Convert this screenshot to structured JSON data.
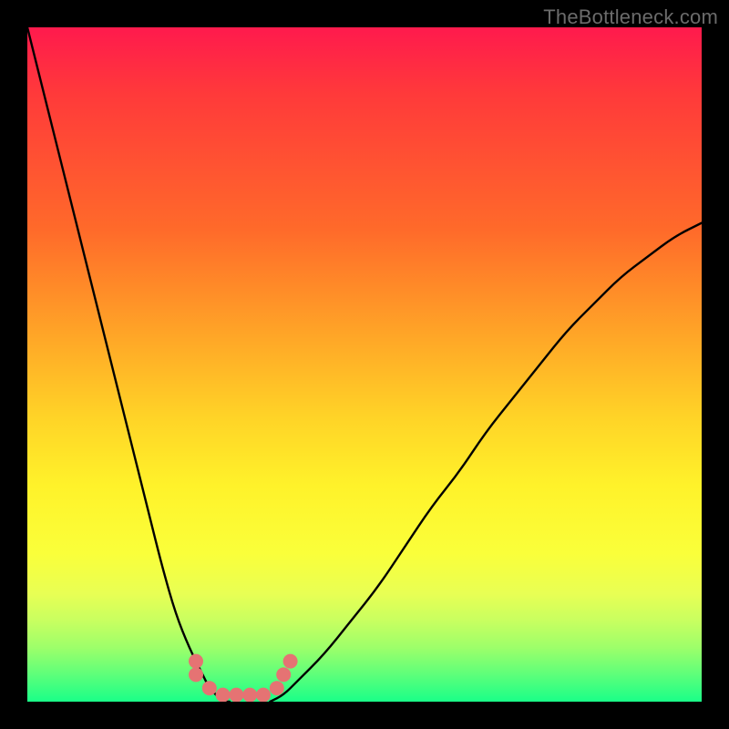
{
  "watermark": "TheBottleneck.com",
  "chart_data": {
    "type": "line",
    "title": "",
    "xlabel": "",
    "ylabel": "",
    "xlim": [
      0,
      100
    ],
    "ylim": [
      0,
      100
    ],
    "grid": false,
    "legend": false,
    "background_gradient": [
      "#ff1a4d",
      "#ff6a2a",
      "#ffd427",
      "#faff3a",
      "#1aff88"
    ],
    "series": [
      {
        "name": "left-curve",
        "color": "#000000",
        "x": [
          0,
          2,
          4,
          6,
          8,
          10,
          12,
          14,
          16,
          18,
          20,
          22,
          24,
          26,
          27,
          28,
          29,
          30
        ],
        "y": [
          100,
          92,
          84,
          76,
          68,
          60,
          52,
          44,
          36,
          28,
          20,
          13,
          8,
          4,
          2,
          1,
          0,
          0
        ]
      },
      {
        "name": "right-curve",
        "color": "#000000",
        "x": [
          36,
          38,
          40,
          44,
          48,
          52,
          56,
          60,
          64,
          68,
          72,
          76,
          80,
          84,
          88,
          92,
          96,
          100
        ],
        "y": [
          0,
          1,
          3,
          7,
          12,
          17,
          23,
          29,
          34,
          40,
          45,
          50,
          55,
          59,
          63,
          66,
          69,
          71
        ]
      },
      {
        "name": "markers",
        "color": "#e57373",
        "type": "scatter",
        "x": [
          25,
          25,
          27,
          29,
          31,
          33,
          35,
          37,
          38,
          39
        ],
        "y": [
          6,
          4,
          2,
          1,
          1,
          1,
          1,
          2,
          4,
          6
        ]
      }
    ],
    "annotations": []
  }
}
